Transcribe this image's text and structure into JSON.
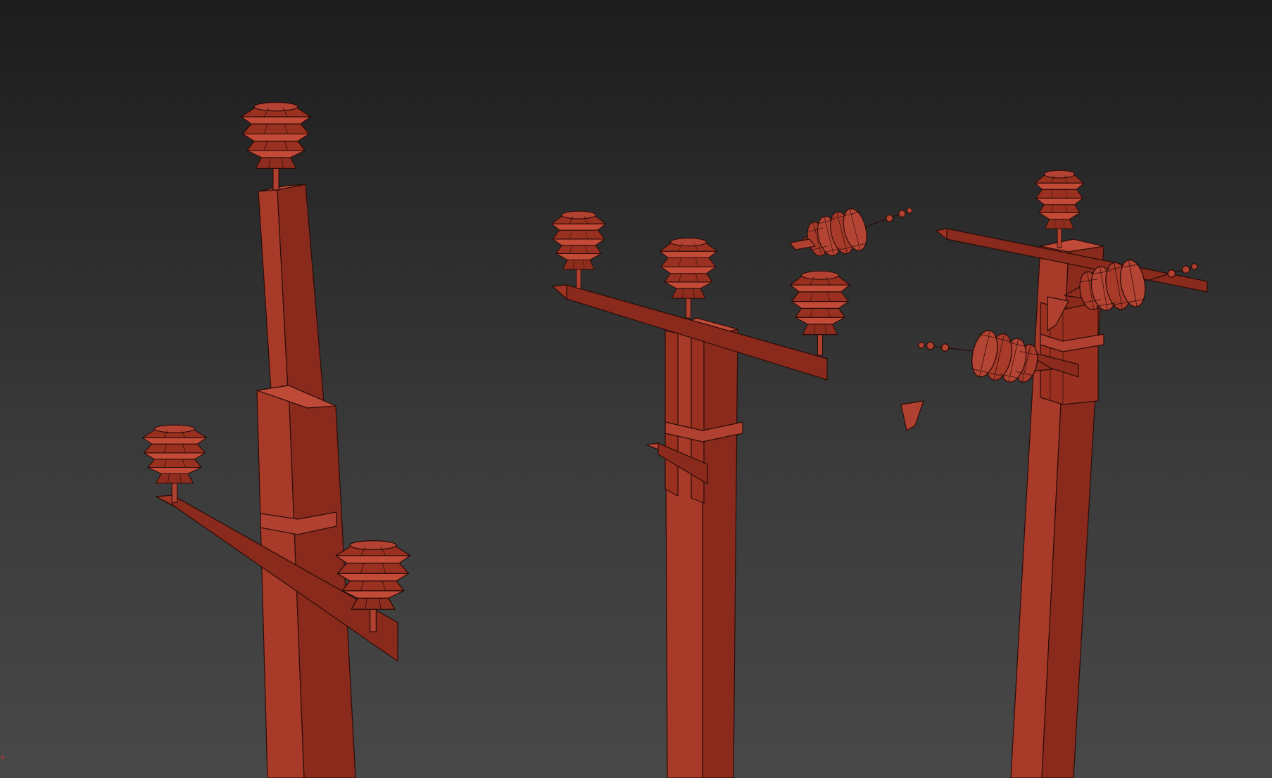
{
  "viewport": {
    "axis_marker": "x"
  },
  "colors": {
    "mesh_face": "#a83a2a",
    "mesh_light": "#c44a38",
    "mesh_dark": "#7e2518",
    "mesh_edge": "#2a0d08",
    "bg_top": "#1c1c1c",
    "bg_bottom": "#484848",
    "axis_red": "#e03020"
  }
}
